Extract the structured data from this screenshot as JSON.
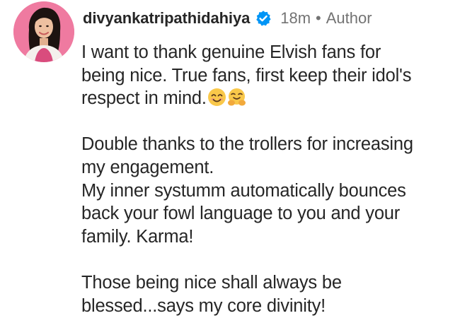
{
  "comment": {
    "username": "divyankatripathidahiya",
    "verified_icon": "verified-badge-icon",
    "time": "18m",
    "separator": "•",
    "role": "Author",
    "avatar_icon": "profile-avatar",
    "paragraph1": {
      "line1": "I want to thank genuine Elvish fans for",
      "line2": "being nice. True fans, first keep their idol's",
      "line3": "respect in mind.",
      "emojis": [
        "smiling-face-icon",
        "hugging-face-icon"
      ]
    },
    "paragraph2": {
      "line1": "Double thanks to the trollers for increasing",
      "line2": "my engagement.",
      "line3": "My inner systumm automatically bounces",
      "line4": "back your fowl language to you and your",
      "line5": "family. Karma!"
    },
    "paragraph3": {
      "line1": "Those being nice shall always be",
      "line2": "blessed...says my core divinity!"
    }
  },
  "colors": {
    "text": "#262626",
    "muted": "#737373",
    "verified": "#0095f6",
    "avatar_bg": "#ef6f9a"
  }
}
